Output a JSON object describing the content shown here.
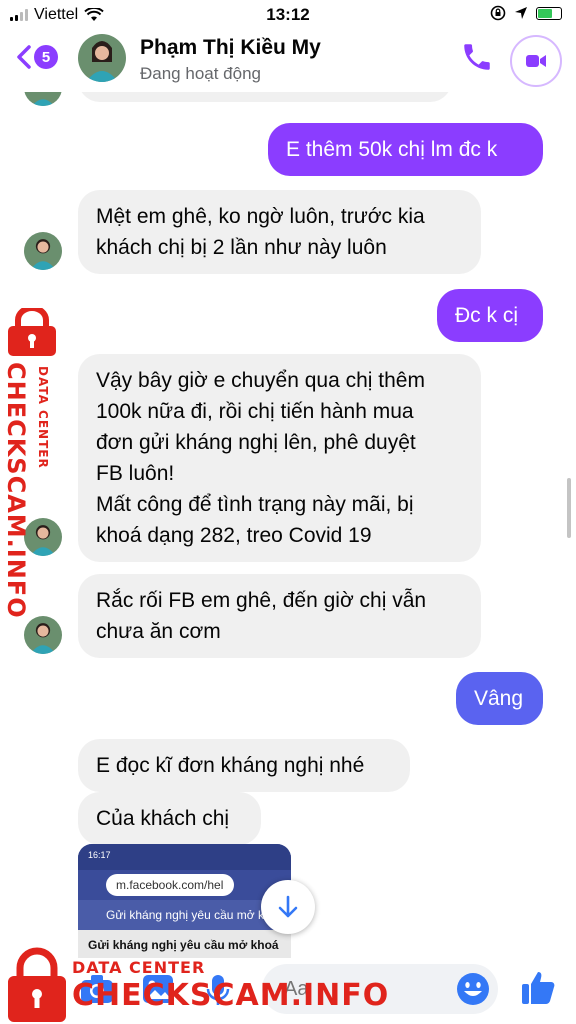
{
  "status_bar": {
    "carrier": "Viettel",
    "time": "13:12"
  },
  "header": {
    "back_badge": "5",
    "contact_name": "Phạm Thị Kiều My",
    "contact_status": "Đang hoạt động"
  },
  "messages": [
    {
      "from": "me",
      "text": "E thêm 50k chị lm đc k"
    },
    {
      "from": "them",
      "lines": [
        "Mệt em ghê, ko ngờ luôn, trước kia",
        "khách chị bị 2 lần như này luôn"
      ]
    },
    {
      "from": "me",
      "text": "Đc k cị"
    },
    {
      "from": "them",
      "lines": [
        "Vậy bây giờ e chuyển qua chị thêm",
        "100k nữa đi, rồi chị tiến hành mua",
        "đơn gửi kháng nghị lên, phê duyệt",
        "FB luôn!",
        "Mất công để tình trạng này mãi, bị",
        "khoá dạng 282, treo Covid 19"
      ]
    },
    {
      "from": "them",
      "lines": [
        "Rắc rối FB em ghê, đến giờ chị vẫn",
        "chưa ăn cơm"
      ]
    },
    {
      "from": "me",
      "text": "Vâng"
    },
    {
      "from": "them",
      "text": "E đọc kĩ đơn kháng nghị nhé"
    },
    {
      "from": "them",
      "text": "Của khách chị"
    }
  ],
  "photo": {
    "time": "16:17",
    "url": "m.facebook.com/hel",
    "nav_title": "Gửi kháng nghị yêu cầu mở khoá",
    "heading": "Gửi kháng nghị yêu cầu mở khoá"
  },
  "composer": {
    "placeholder": "Aa"
  },
  "watermark": {
    "label_small": "DATA CENTER",
    "label_big": "CHECKSCAM.INFO"
  },
  "colors": {
    "accent": "#8b3dff",
    "blue_bubble": "#5a63f0",
    "incoming": "#f0f0f0",
    "watermark": "#e0241c"
  },
  "icons": [
    "signal-icon",
    "wifi-icon",
    "lock-rotation-icon",
    "location-icon",
    "battery-icon",
    "back-chevron-icon",
    "phone-icon",
    "video-icon",
    "scroll-down-icon",
    "camera-icon",
    "image-icon",
    "microphone-icon",
    "emoji-icon",
    "like-icon",
    "lock-icon"
  ]
}
